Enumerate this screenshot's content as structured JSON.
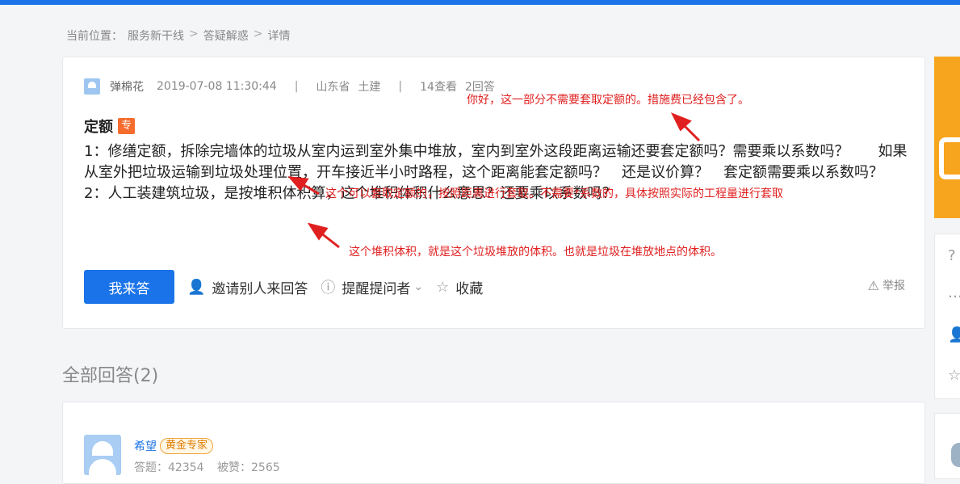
{
  "breadcrumb": {
    "prefix": "当前位置：",
    "items": [
      "服务新干线",
      "答疑解惑",
      "详情"
    ],
    "separator": ">"
  },
  "question": {
    "user": "弹棉花",
    "datetime": "2019-07-08 11:30:44",
    "divider": "|",
    "region": "山东省",
    "category": "土建",
    "views": "14查看",
    "answers": "2回答",
    "title": "定额",
    "badge": "专",
    "lines": [
      "1：修缮定额，拆除完墙体的垃圾从室内运到室外集中堆放，室内到室外这段距离运输还要套定额吗？需要乘以系数吗？　　如果从室外把垃圾运输到垃圾处理位置，开车接近半小时路程，这个距离能套定额吗？　还是议价算？　套定额需要乘以系数吗？",
      "2：人工装建筑垃圾，是按堆积体积算，这个堆积体积什么意思？还要乘以系数吗？"
    ]
  },
  "actions": {
    "answer_btn": "我来答",
    "invite": "邀请别人来回答",
    "remind": "提醒提问者",
    "favorite": "收藏",
    "report": "举报"
  },
  "annotations": [
    "你好，这一部分不需要套取定额的。措施费已经包含了。",
    "这个可以套取定额的，按照距离进行套取。不需要*系数的，具体按照实际的工程量进行套取",
    "这个堆积体积，就是这个垃圾堆放的体积。也就是垃圾在堆放地点的体积。"
  ],
  "answers_section": {
    "heading": "全部回答(2)"
  },
  "answer1": {
    "user": "希望",
    "badge": "黄金专家",
    "answers_label": "答题：42354",
    "likes_label": "被赞：2565"
  },
  "colors": {
    "accent": "#1a73e8",
    "annotation": "#e02020",
    "badge": "#f56c2d"
  }
}
